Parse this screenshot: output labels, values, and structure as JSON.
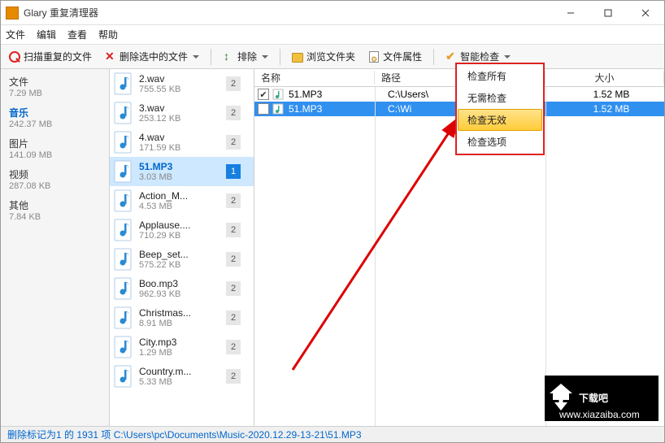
{
  "window": {
    "title": "Glary 重复清理器"
  },
  "menubar": [
    "文件",
    "编辑",
    "查看",
    "帮助"
  ],
  "toolbar": {
    "scan": "扫描重复的文件",
    "delete": "删除选中的文件",
    "sort": "排除",
    "browse": "浏览文件夹",
    "props": "文件属性",
    "smart": "智能检查"
  },
  "categories": [
    {
      "name": "文件",
      "size": "7.29 MB",
      "active": false
    },
    {
      "name": "音乐",
      "size": "242.37 MB",
      "active": true
    },
    {
      "name": "图片",
      "size": "141.09 MB",
      "active": false
    },
    {
      "name": "视频",
      "size": "287.08 KB",
      "active": false
    },
    {
      "name": "其他",
      "size": "7.84 KB",
      "active": false
    }
  ],
  "files": [
    {
      "name": "2.wav",
      "size": "755.55 KB",
      "count": "2",
      "sel": false
    },
    {
      "name": "3.wav",
      "size": "253.12 KB",
      "count": "2",
      "sel": false
    },
    {
      "name": "4.wav",
      "size": "171.59 KB",
      "count": "2",
      "sel": false
    },
    {
      "name": "51.MP3",
      "size": "3.03 MB",
      "count": "1",
      "sel": true
    },
    {
      "name": "Action_M...",
      "size": "4.53 MB",
      "count": "2",
      "sel": false
    },
    {
      "name": "Applause....",
      "size": "710.29 KB",
      "count": "2",
      "sel": false
    },
    {
      "name": "Beep_set...",
      "size": "575.22 KB",
      "count": "2",
      "sel": false
    },
    {
      "name": "Boo.mp3",
      "size": "962.93 KB",
      "count": "2",
      "sel": false
    },
    {
      "name": "Christmas...",
      "size": "8.91 MB",
      "count": "2",
      "sel": false
    },
    {
      "name": "City.mp3",
      "size": "1.29 MB",
      "count": "2",
      "sel": false
    },
    {
      "name": "Country.m...",
      "size": "5.33 MB",
      "count": "2",
      "sel": false
    }
  ],
  "details": {
    "headers": {
      "name": "名称",
      "path": "路径",
      "size": "大小"
    },
    "rows": [
      {
        "checked": true,
        "name": "51.MP3",
        "path": "C:\\Users\\",
        "size": "1.52 MB",
        "sel": false
      },
      {
        "checked": false,
        "name": "51.MP3",
        "path": "C:\\Wi",
        "size": "1.52 MB",
        "sel": true
      }
    ]
  },
  "menu": [
    "检查所有",
    "无需检查",
    "检查无效",
    "检查选项"
  ],
  "menu_highlight_index": 2,
  "status": "删除标记为1 的 1931 项     C:\\Users\\pc\\Documents\\Music-2020.12.29-13-21\\51.MP3",
  "watermark": {
    "text": "下载吧",
    "url": "www.xiazaiba.com"
  }
}
